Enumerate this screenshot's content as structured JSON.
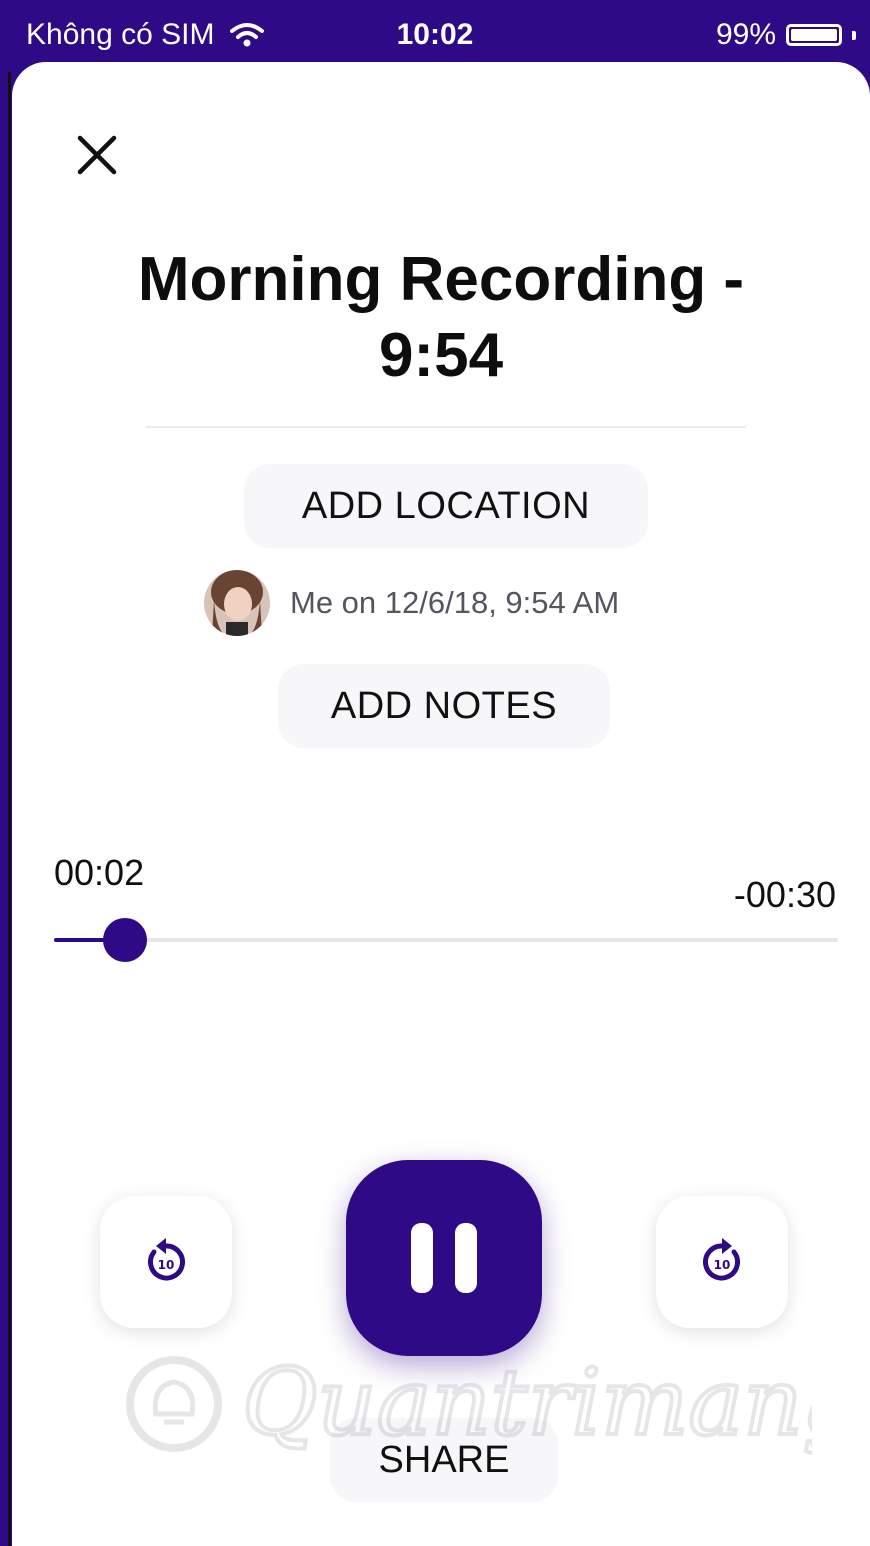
{
  "status_bar": {
    "carrier": "Không có SIM",
    "time": "10:02",
    "battery": "99%",
    "battery_level": 0.99,
    "wifi_icon": "wifi-icon"
  },
  "recording": {
    "title": "Morning Recording - 9:54",
    "add_location_label": "ADD LOCATION",
    "author_line": "Me on 12/6/18, 9:54 AM",
    "add_notes_label": "ADD NOTES"
  },
  "playback": {
    "elapsed": "00:02",
    "remaining": "-00:30",
    "progress": 0.09,
    "skip_back_icon": "rewind-10-icon",
    "skip_forward_icon": "forward-10-icon",
    "pause_icon": "pause-icon",
    "skip_seconds": "10"
  },
  "actions": {
    "share_label": "SHARE"
  },
  "watermark": {
    "text": "Quantrimang"
  },
  "colors": {
    "accent": "#2e0a86",
    "pill_bg": "#f7f7f9"
  }
}
